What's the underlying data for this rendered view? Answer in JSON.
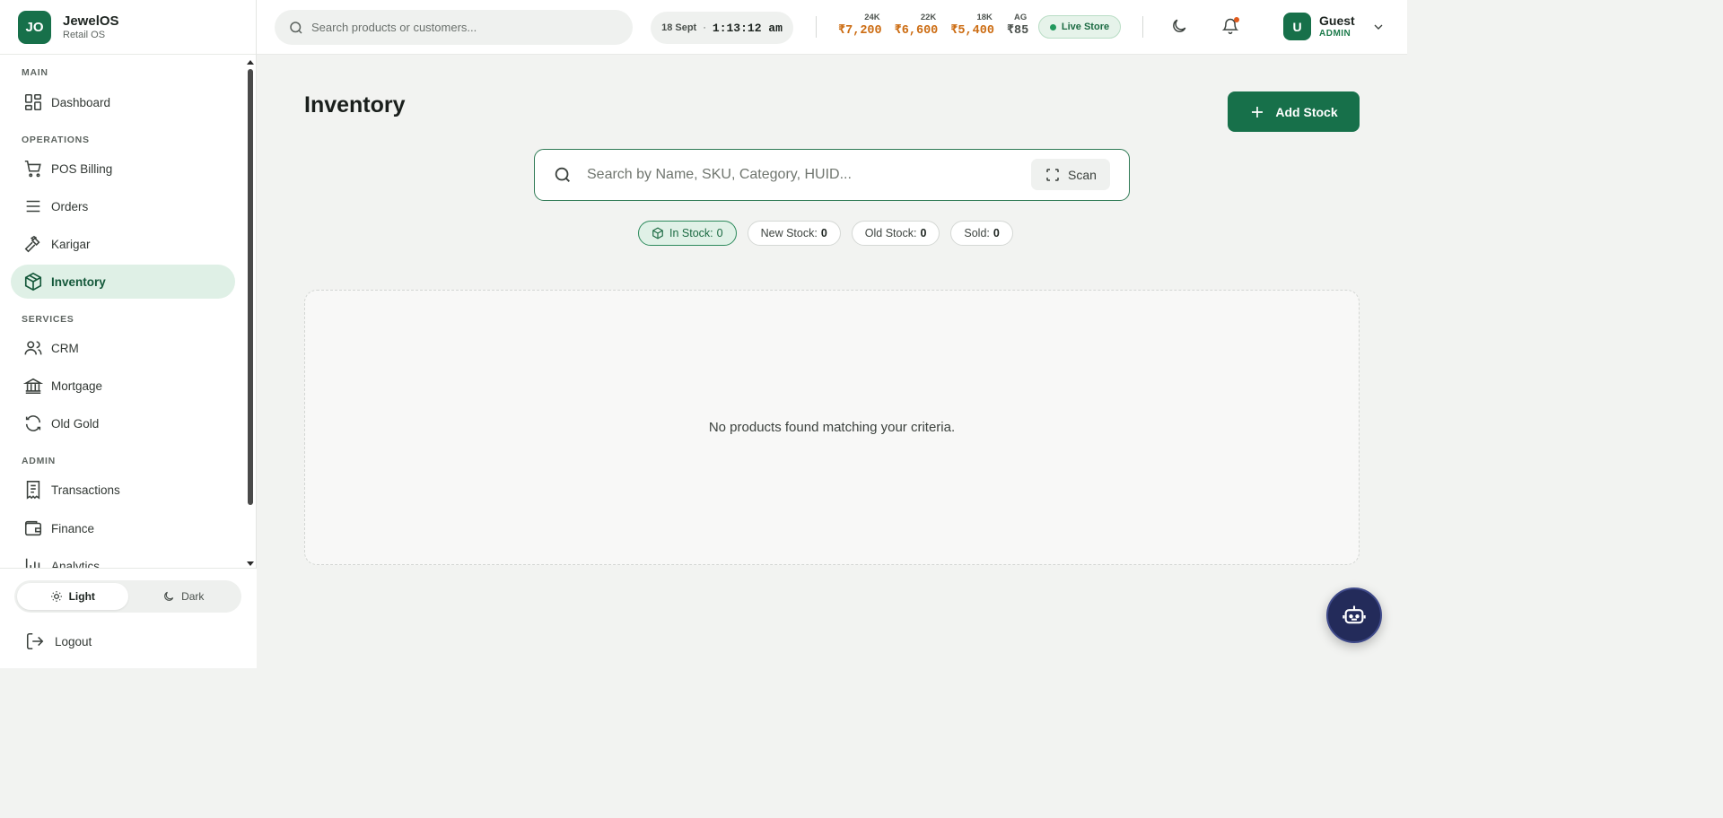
{
  "brand": {
    "initials": "JO",
    "name": "JewelOS",
    "subtitle": "Retail OS"
  },
  "sidebar": {
    "sections": {
      "main": "MAIN",
      "operations": "OPERATIONS",
      "services": "SERVICES",
      "admin": "ADMIN"
    },
    "items": [
      {
        "label": "Dashboard",
        "icon": "dashboard-icon"
      },
      {
        "label": "POS Billing",
        "icon": "cart-icon"
      },
      {
        "label": "Orders",
        "icon": "list-icon"
      },
      {
        "label": "Karigar",
        "icon": "hammer-icon"
      },
      {
        "label": "Inventory",
        "icon": "package-icon",
        "active": true
      },
      {
        "label": "CRM",
        "icon": "users-icon"
      },
      {
        "label": "Mortgage",
        "icon": "bank-icon"
      },
      {
        "label": "Old Gold",
        "icon": "refresh-icon"
      },
      {
        "label": "Transactions",
        "icon": "receipt-icon"
      },
      {
        "label": "Finance",
        "icon": "wallet-icon"
      },
      {
        "label": "Analytics",
        "icon": "chart-icon"
      }
    ],
    "theme": {
      "light": "Light",
      "dark": "Dark",
      "selected": "light"
    },
    "logout": "Logout"
  },
  "header": {
    "search_placeholder": "Search products or customers...",
    "date": "18 Sept",
    "separator": "·",
    "time": "1:13:12 am",
    "rates": [
      {
        "label": "24K",
        "value": "₹7,200"
      },
      {
        "label": "22K",
        "value": "₹6,600"
      },
      {
        "label": "18K",
        "value": "₹5,400"
      },
      {
        "label": "AG",
        "value": "₹85"
      }
    ],
    "live_store": "Live Store",
    "user": {
      "initial": "U",
      "name": "Guest",
      "role": "ADMIN"
    }
  },
  "main": {
    "title": "Inventory",
    "add_stock_label": "Add Stock",
    "search_placeholder": "Search by Name, SKU, Category, HUID...",
    "scan_label": "Scan",
    "filters": [
      {
        "label": "In Stock:",
        "count": "0",
        "active": true
      },
      {
        "label": "New Stock:",
        "count": "0"
      },
      {
        "label": "Old Stock:",
        "count": "0"
      },
      {
        "label": "Sold:",
        "count": "0"
      }
    ],
    "empty_message": "No products found matching your criteria."
  },
  "colors": {
    "primary": "#17704a",
    "accent_orange": "#cc6c12",
    "fab": "#232b5a"
  }
}
